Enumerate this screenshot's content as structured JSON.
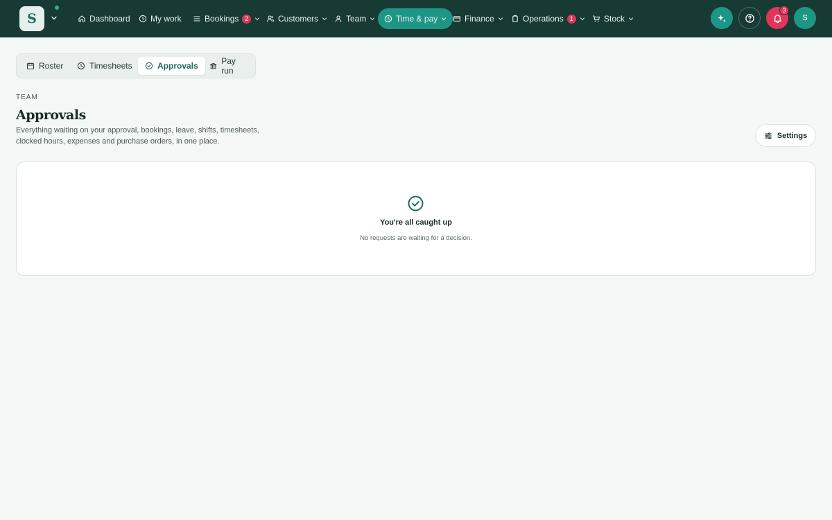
{
  "app": {
    "logo_letter": "S"
  },
  "nav": [
    {
      "key": "dashboard",
      "label": "Dashboard",
      "icon": "home-icon"
    },
    {
      "key": "my-work",
      "label": "My work",
      "icon": "clock-icon"
    },
    {
      "key": "bookings",
      "label": "Bookings",
      "icon": "list-icon",
      "badge": "2"
    },
    {
      "key": "customers",
      "label": "Customers",
      "icon": "users-icon"
    },
    {
      "key": "team",
      "label": "Team",
      "icon": "team-icon"
    },
    {
      "key": "time-pay",
      "label": "Time & pay",
      "icon": "clock-icon",
      "active": true
    },
    {
      "key": "finance",
      "label": "Finance",
      "icon": "card-icon"
    },
    {
      "key": "operations",
      "label": "Operations",
      "icon": "clipboard-icon",
      "badge": "1"
    },
    {
      "key": "stock",
      "label": "Stock",
      "icon": "cart-icon"
    }
  ],
  "header_actions": {
    "notifications_count": "3",
    "avatar_initial": "S"
  },
  "tabs": [
    {
      "label": "Roster",
      "icon": "calendar-icon"
    },
    {
      "label": "Timesheets",
      "icon": "clock-icon"
    },
    {
      "label": "Approvals",
      "icon": "check-circle-icon",
      "active": true
    },
    {
      "label": "Pay run",
      "icon": "bank-icon"
    }
  ],
  "page": {
    "eyebrow": "TEAM",
    "title": "Approvals",
    "description": "Everything waiting on your approval, bookings, leave, shifts, timesheets, clocked hours, expenses and purchase orders, in one place.",
    "settings_label": "Settings"
  },
  "empty_state": {
    "title": "You're all caught up",
    "subtitle": "No requests are waiting for a decision."
  },
  "colors": {
    "topbar": "#173a35",
    "accent": "#1e9685",
    "alert": "#e2355a",
    "background": "#f3f7f6"
  }
}
